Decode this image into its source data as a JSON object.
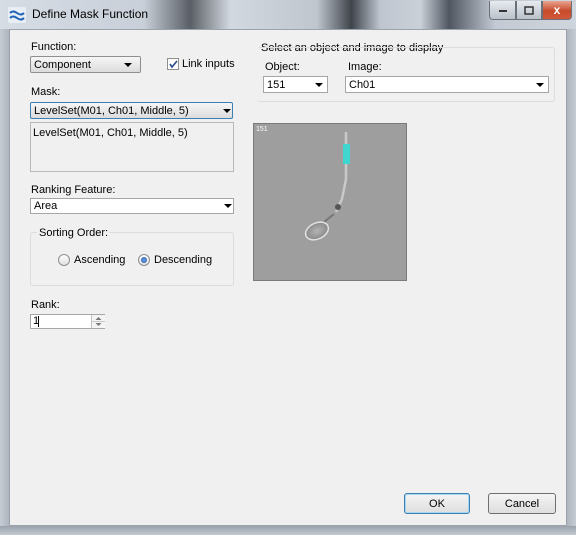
{
  "window": {
    "title": "Define Mask Function",
    "icon": "wave-icon",
    "minimize_icon": "minimize-icon",
    "maximize_icon": "maximize-icon",
    "close_glyph": "x"
  },
  "function": {
    "label": "Function:",
    "value": "Component"
  },
  "link_inputs": {
    "label": "Link inputs",
    "checked": true
  },
  "mask": {
    "label": "Mask:",
    "value": "LevelSet(M01, Ch01, Middle, 5)",
    "display": "LevelSet(M01, Ch01, Middle, 5)"
  },
  "ranking_feature": {
    "label": "Ranking Feature:",
    "value": "Area"
  },
  "sorting_order": {
    "label": "Sorting Order:",
    "ascending": "Ascending",
    "descending": "Descending",
    "selected": "Descending"
  },
  "rank": {
    "label": "Rank:",
    "value": "1"
  },
  "display": {
    "group_label": "Select an object and image to display",
    "object_label": "Object:",
    "object_value": "151",
    "image_label": "Image:",
    "image_value": "Ch01"
  },
  "preview": {
    "object_id": "151",
    "colors": {
      "background": "#9c9c9c",
      "highlight": "#3fd6cf"
    }
  },
  "buttons": {
    "ok": "OK",
    "cancel": "Cancel"
  }
}
